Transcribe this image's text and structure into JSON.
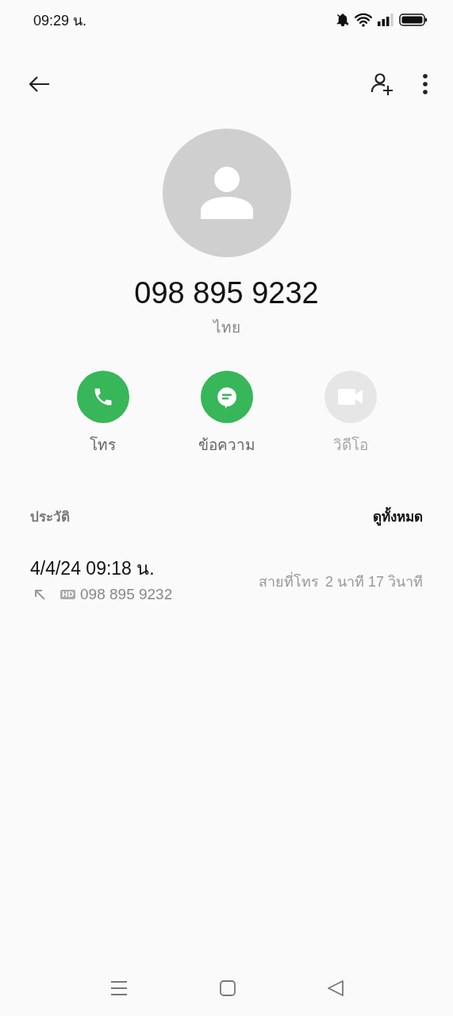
{
  "status_bar": {
    "time": "09:29 น."
  },
  "contact": {
    "number": "098 895 9232",
    "country": "ไทย"
  },
  "actions": [
    {
      "kind": "call",
      "label": "โทร",
      "disabled": false
    },
    {
      "kind": "message",
      "label": "ข้อความ",
      "disabled": false
    },
    {
      "kind": "video",
      "label": "วิดีโอ",
      "disabled": true
    }
  ],
  "history": {
    "title": "ประวัติ",
    "see_all": "ดูทั้งหมด",
    "entries": [
      {
        "datetime": "4/4/24 09:18 น.",
        "kind": "outgoing",
        "badge": "HD",
        "number": "098 895 9232",
        "type": "สายที่โทร",
        "duration": "2 นาที 17 วินาที"
      }
    ]
  }
}
